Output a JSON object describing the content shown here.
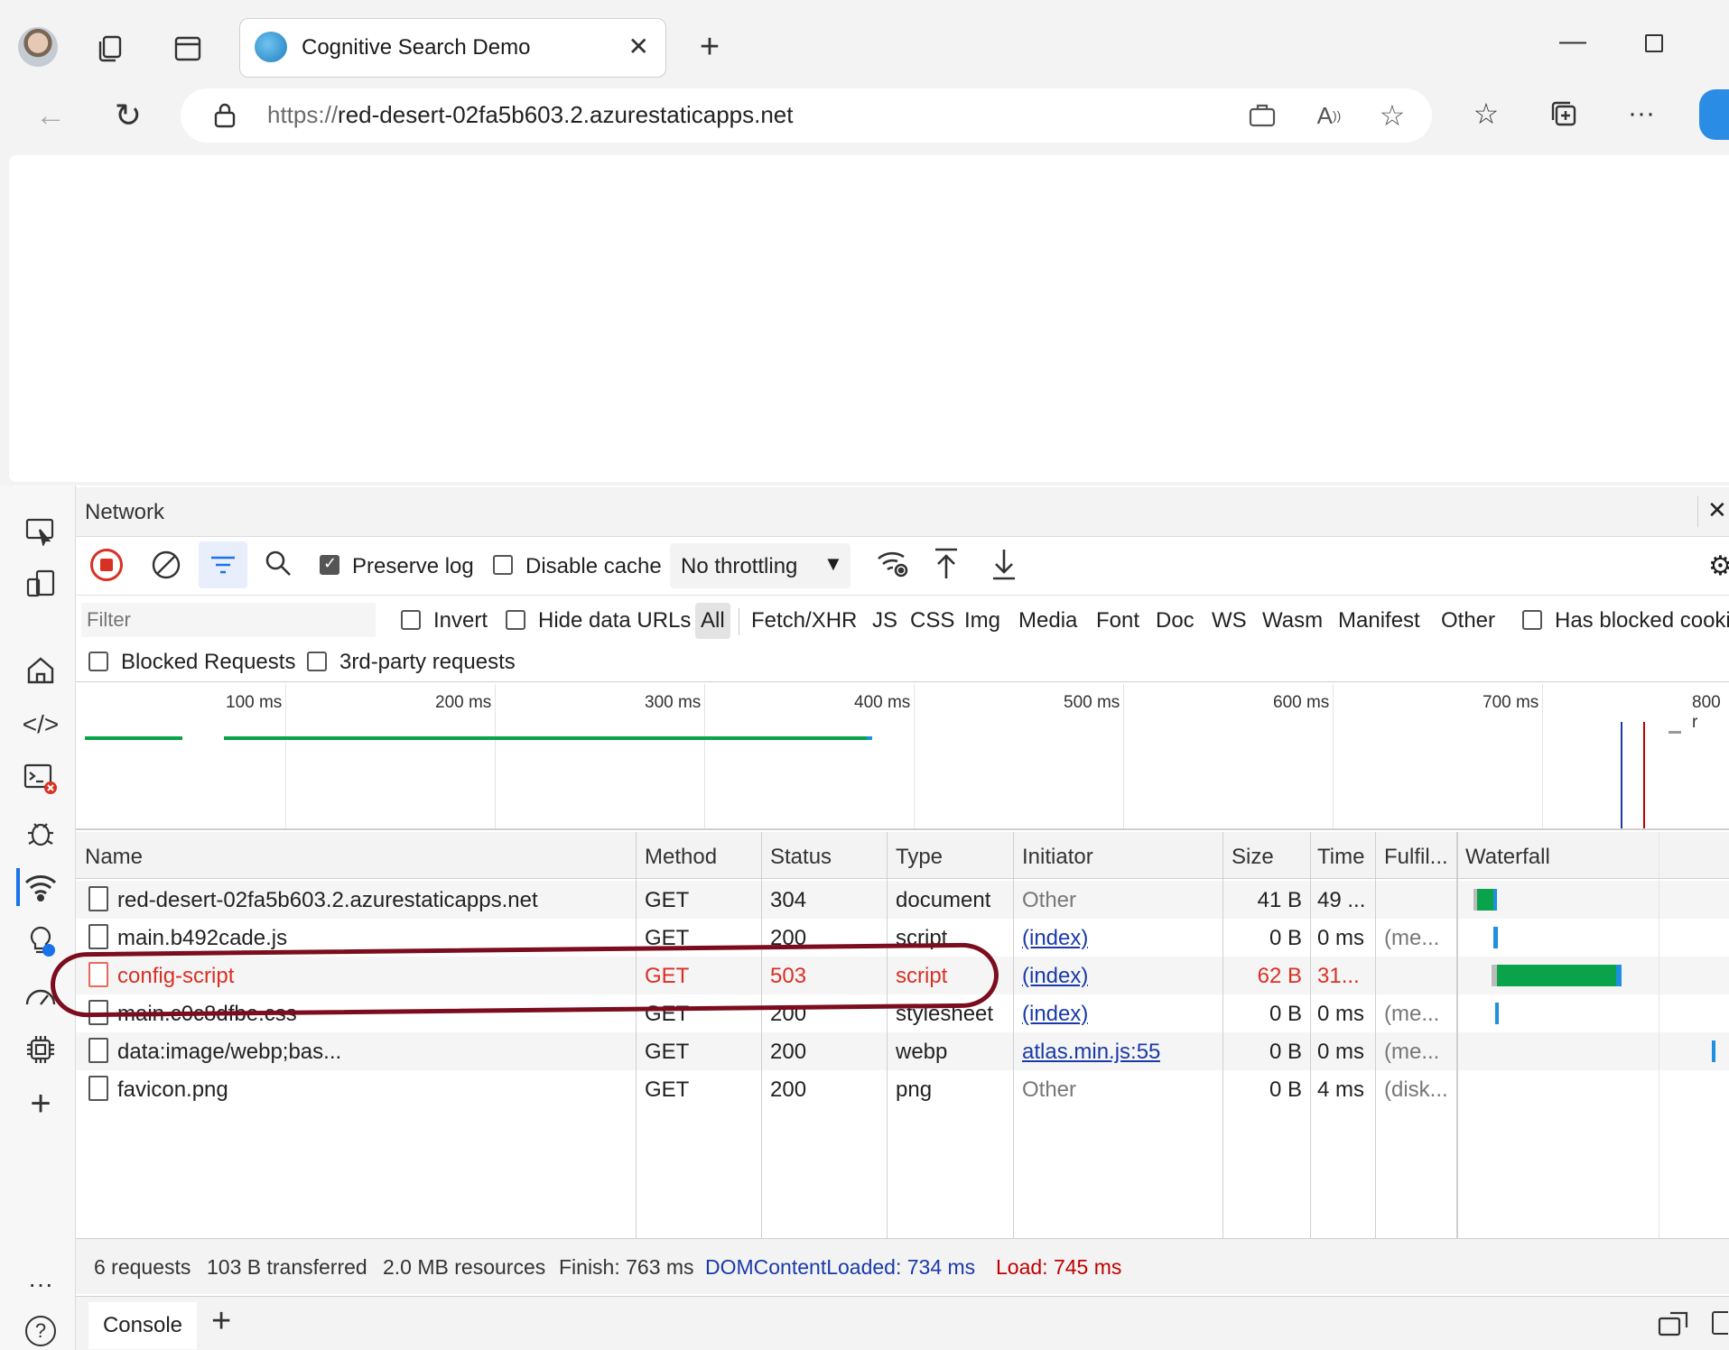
{
  "browser": {
    "tab_title": "Cognitive Search Demo",
    "url_prefix": "https://",
    "url_host": "red-desert-02fa5b603.2.azurestaticapps.net"
  },
  "devtools": {
    "panel_title": "Network",
    "toolbar": {
      "preserve_log_label": "Preserve log",
      "disable_cache_label": "Disable cache",
      "throttling_value": "No throttling"
    },
    "filter": {
      "placeholder": "Filter",
      "invert_label": "Invert",
      "hide_data_urls_label": "Hide data URLs",
      "types": [
        "All",
        "Fetch/XHR",
        "JS",
        "CSS",
        "Img",
        "Media",
        "Font",
        "Doc",
        "WS",
        "Wasm",
        "Manifest",
        "Other"
      ],
      "has_blocked_cookies_label": "Has blocked cooki",
      "blocked_requests_label": "Blocked Requests",
      "third_party_label": "3rd-party requests"
    },
    "timeline_ticks": [
      "100 ms",
      "200 ms",
      "300 ms",
      "400 ms",
      "500 ms",
      "600 ms",
      "700 ms",
      "800 r"
    ],
    "columns": [
      "Name",
      "Method",
      "Status",
      "Type",
      "Initiator",
      "Size",
      "Time",
      "Fulfil...",
      "Waterfall"
    ],
    "rows": [
      {
        "name": "red-desert-02fa5b603.2.azurestaticapps.net",
        "method": "GET",
        "status": "304",
        "type": "document",
        "initiator": "Other",
        "size": "41 B",
        "time": "49 ...",
        "fulfilled": ""
      },
      {
        "name": "main.b492cade.js",
        "method": "GET",
        "status": "200",
        "type": "script",
        "initiator": "(index)",
        "size": "0 B",
        "time": "0 ms",
        "fulfilled": "(me..."
      },
      {
        "name": "config-script",
        "method": "GET",
        "status": "503",
        "type": "script",
        "initiator": "(index)",
        "size": "62 B",
        "time": "31...",
        "fulfilled": ""
      },
      {
        "name": "main.c0c8dfbe.css",
        "method": "GET",
        "status": "200",
        "type": "stylesheet",
        "initiator": "(index)",
        "size": "0 B",
        "time": "0 ms",
        "fulfilled": "(me..."
      },
      {
        "name": "data:image/webp;bas...",
        "method": "GET",
        "status": "200",
        "type": "webp",
        "initiator": "atlas.min.js:55",
        "size": "0 B",
        "time": "0 ms",
        "fulfilled": "(me..."
      },
      {
        "name": "favicon.png",
        "method": "GET",
        "status": "200",
        "type": "png",
        "initiator": "Other",
        "size": "0 B",
        "time": "4 ms",
        "fulfilled": "(disk..."
      }
    ],
    "summary": {
      "requests": "6 requests",
      "transferred": "103 B transferred",
      "resources": "2.0 MB resources",
      "finish": "Finish: 763 ms",
      "dom_content_loaded": "DOMContentLoaded: 734 ms",
      "load": "Load: 745 ms"
    },
    "drawer_tab": "Console"
  },
  "colors": {
    "error": "#d93025",
    "dcl_blue": "#1a3aa8",
    "load_red": "#c00000",
    "waterfall_green": "#0aa24a",
    "waterfall_blue": "#1e90e0",
    "annotation": "#7b0d1e"
  }
}
